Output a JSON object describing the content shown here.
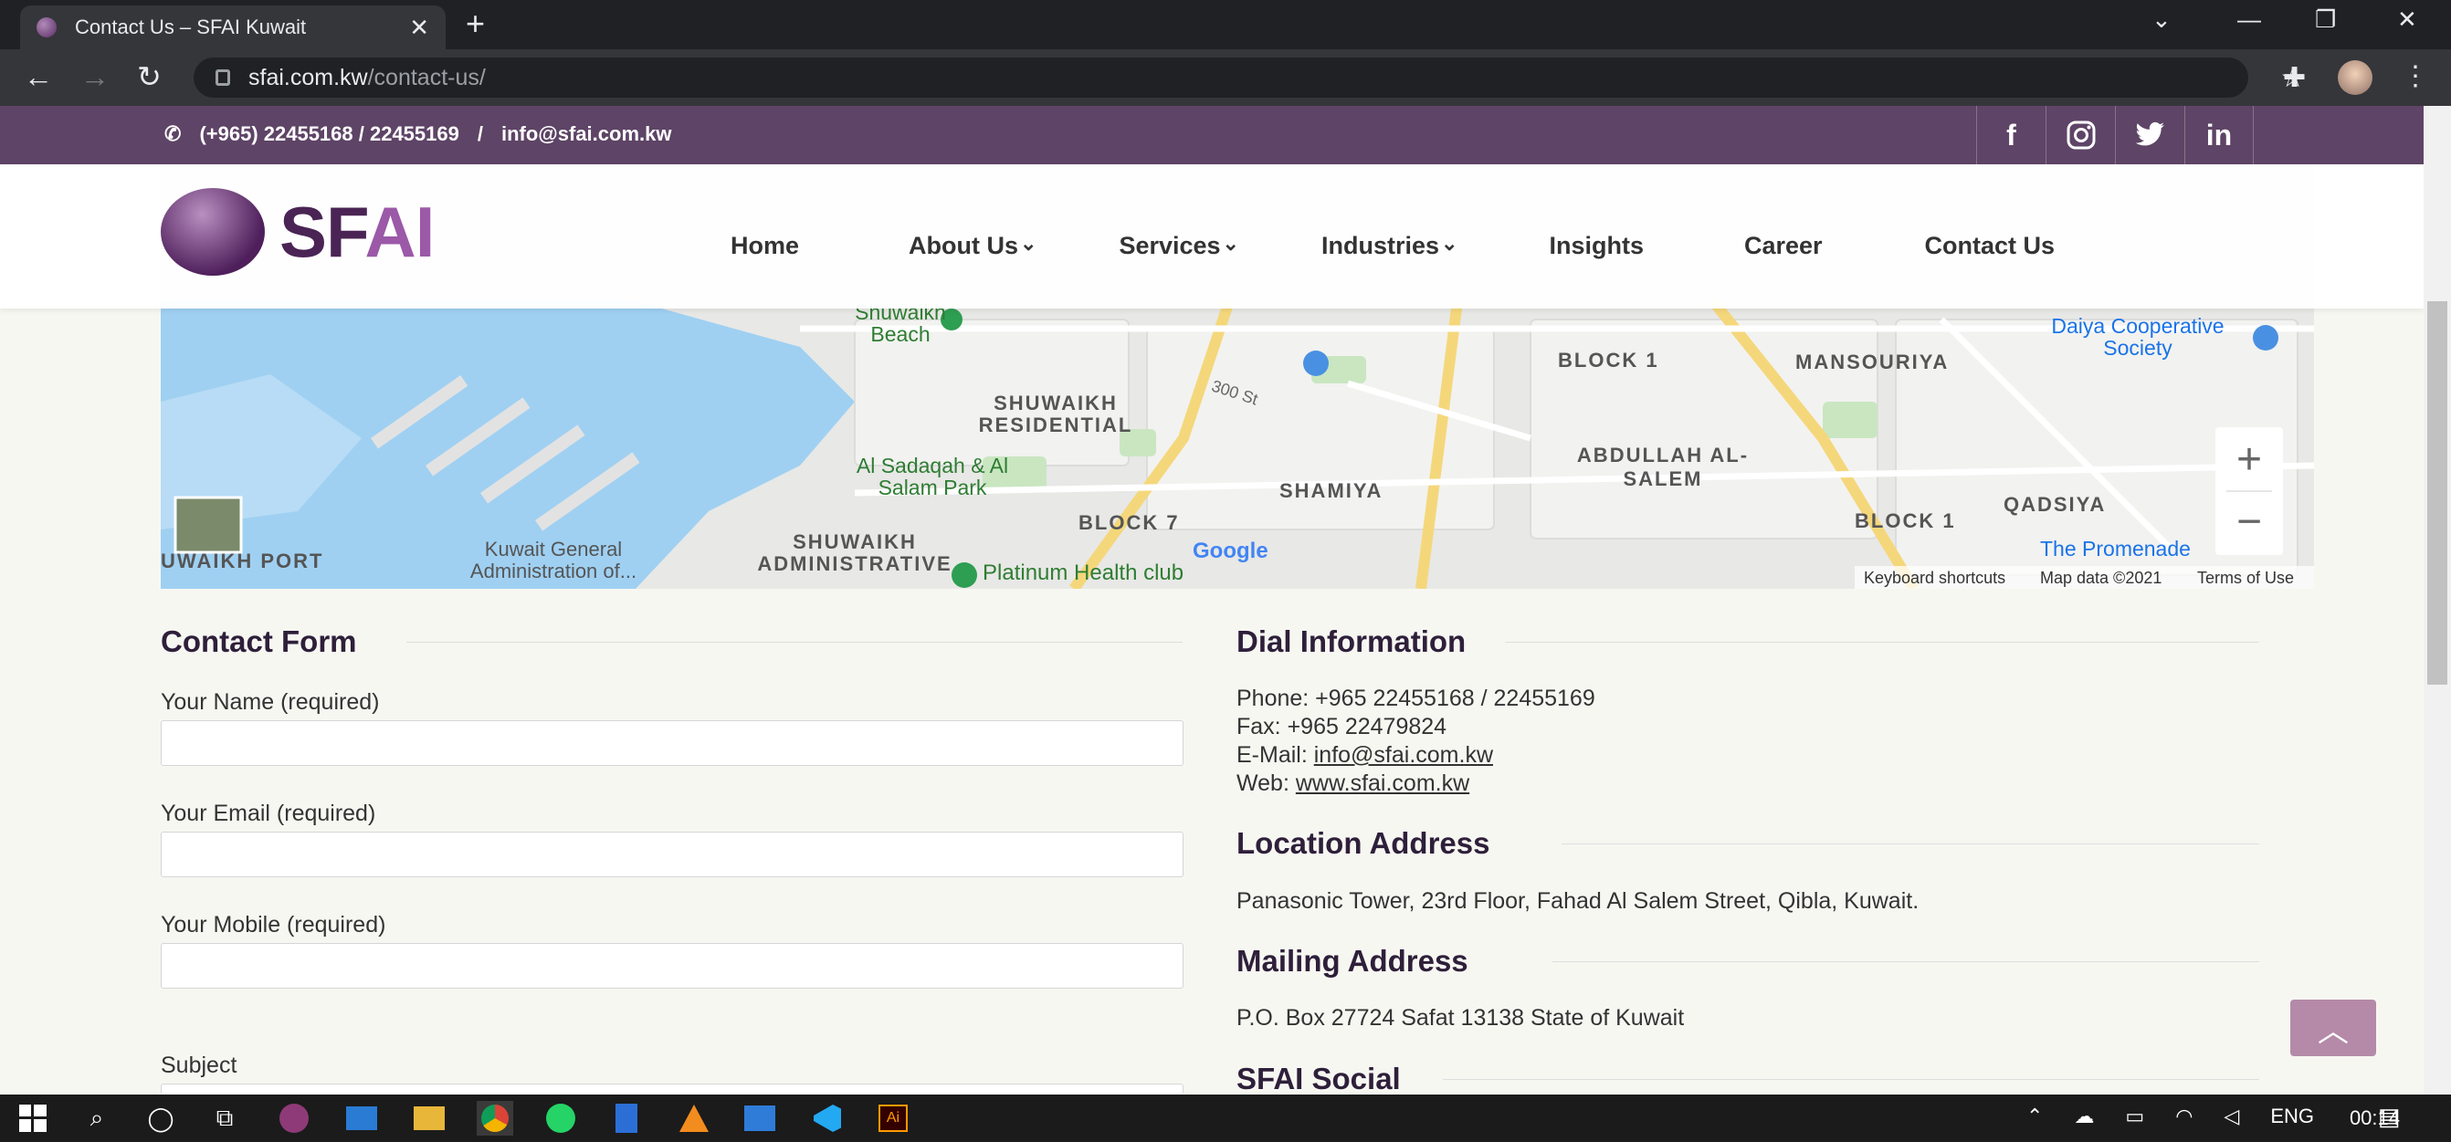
{
  "browser": {
    "tab_title": "Contact Us – SFAI Kuwait",
    "url_host": "sfai.com.kw",
    "url_path": "/contact-us/"
  },
  "topbar": {
    "phone": "(+965) 22455168 / 22455169",
    "separator": "/",
    "email": "info@sfai.com.kw",
    "social": [
      "f",
      "ig",
      "tw",
      "in"
    ]
  },
  "header": {
    "logo_text_a": "SF",
    "logo_text_b": "AI",
    "nav": [
      {
        "label": "Home"
      },
      {
        "label": "About Us"
      },
      {
        "label": "Services"
      },
      {
        "label": "Industries"
      },
      {
        "label": "Insights"
      },
      {
        "label": "Career"
      },
      {
        "label": "Contact Us"
      }
    ]
  },
  "map": {
    "labels": {
      "shuwaikh_residential": "SHUWAIKH RESIDENTIAL",
      "block1": "BLOCK 1",
      "mansouriya": "MANSOURIYA",
      "shamiya": "SHAMIYA",
      "abdullah": "ABDULLAH AL-SALEM",
      "qadsiya": "QADSIYA",
      "block7": "BLOCK 7",
      "block1b": "BLOCK 1",
      "shuwaikh_admin": "SHUWAIKH ADMINISTRATIVE",
      "shuwaikh_port": "UWAIKH PORT",
      "kuwait_general": "Kuwait General Administration of...",
      "platinum": "Platinum Health club",
      "sadaqah": "Al Sadaqah & Al Salam Park",
      "beach": "Shuwaikh Beach",
      "daiya": "Daiya Cooperative Society",
      "promenade": "The Promenade",
      "st300": "300 St",
      "google": "Google",
      "shortcuts": "Keyboard shortcuts",
      "mapdata": "Map data ©2021",
      "terms": "Terms of Use"
    },
    "zoom_in": "+",
    "zoom_out": "−"
  },
  "contact_form": {
    "title": "Contact Form",
    "name_label": "Your Name (required)",
    "email_label": "Your Email (required)",
    "mobile_label": "Your Mobile (required)",
    "subject_label": "Subject"
  },
  "dial": {
    "title": "Dial Information",
    "phone": "Phone: +965 22455168 / 22455169",
    "fax": "Fax: +965 22479824",
    "email_prefix": "E-Mail: ",
    "email": "info@sfai.com.kw",
    "web_prefix": "Web: ",
    "web": "www.sfai.com.kw"
  },
  "location": {
    "title": "Location Address",
    "text": "Panasonic Tower, 23rd Floor, Fahad Al Salem Street, Qibla, Kuwait."
  },
  "mailing": {
    "title": "Mailing Address",
    "text": "P.O. Box 27724 Safat 13138 State of Kuwait"
  },
  "social_title": "SFAI Social",
  "taskbar": {
    "lang": "ENG",
    "time": "00:14"
  },
  "colors": {
    "brand_purple": "#5e4466",
    "accent": "#9b59a8"
  }
}
